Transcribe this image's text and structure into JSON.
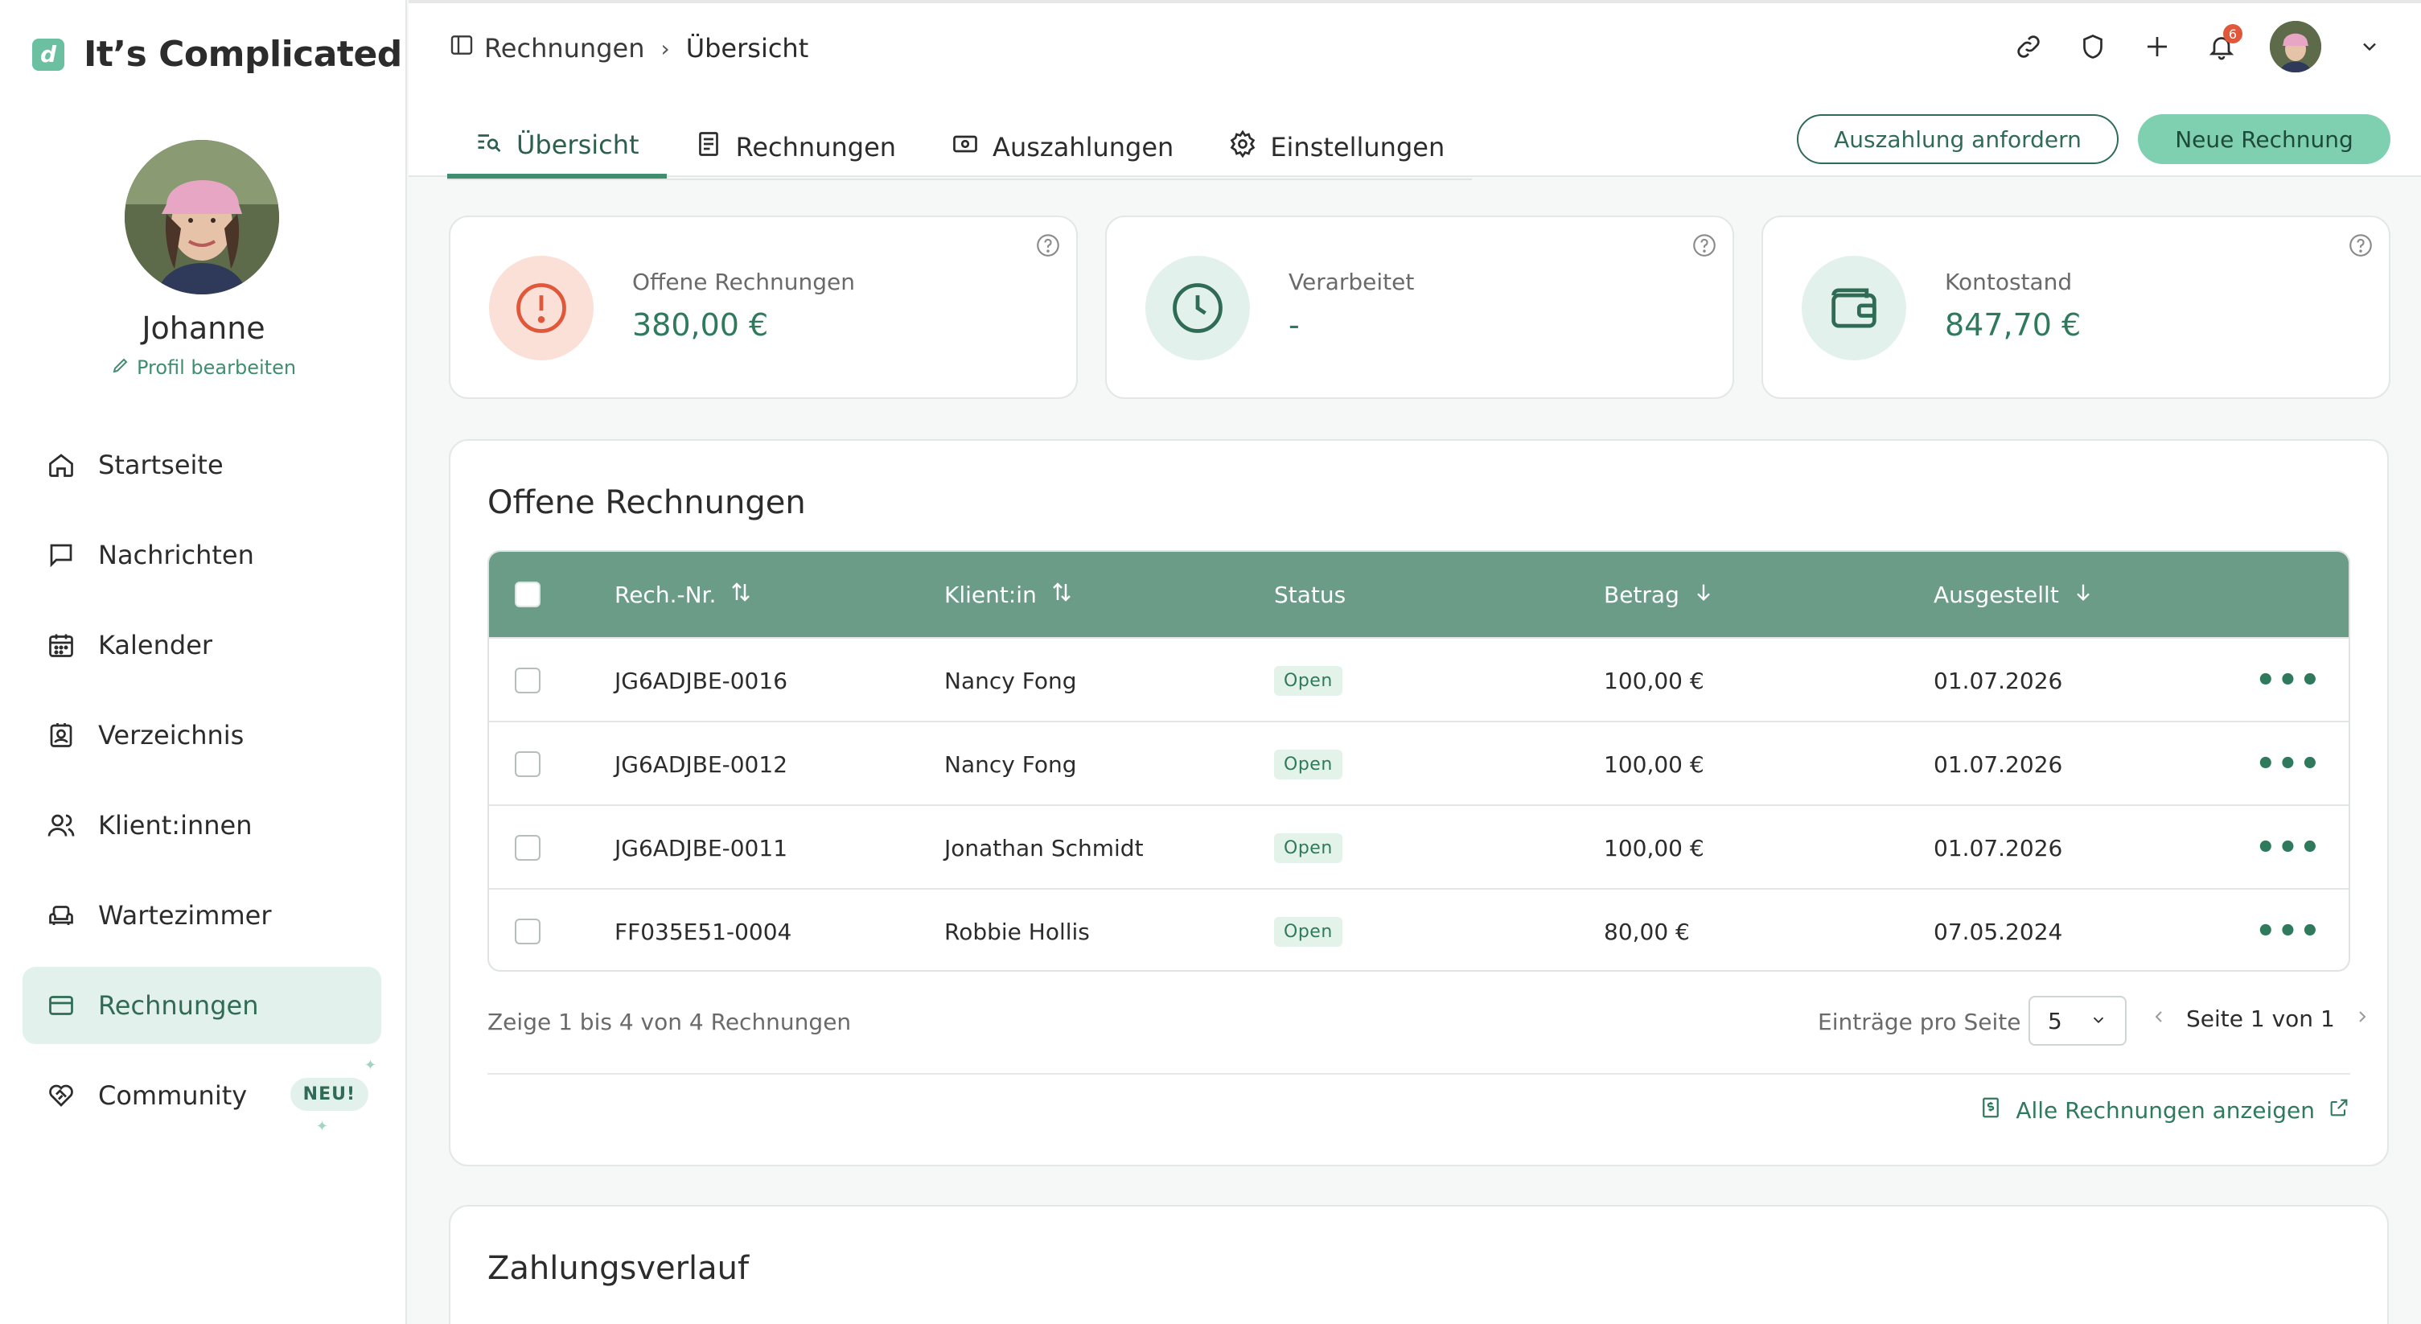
{
  "app": {
    "name": "It’s Complicated",
    "logo_letter": "d"
  },
  "profile": {
    "name": "Johanne",
    "edit_label": "Profil bearbeiten"
  },
  "sidebar": {
    "items": [
      {
        "label": "Startseite",
        "icon": "home-icon"
      },
      {
        "label": "Nachrichten",
        "icon": "message-icon"
      },
      {
        "label": "Kalender",
        "icon": "calendar-icon"
      },
      {
        "label": "Verzeichnis",
        "icon": "directory-icon"
      },
      {
        "label": "Klient:innen",
        "icon": "users-icon"
      },
      {
        "label": "Wartezimmer",
        "icon": "armchair-icon"
      },
      {
        "label": "Rechnungen",
        "icon": "card-icon",
        "active": true
      },
      {
        "label": "Community",
        "icon": "heart-handshake-icon",
        "badge": "NEU!"
      }
    ]
  },
  "breadcrumb": {
    "parent": "Rechnungen",
    "current": "Übersicht"
  },
  "notifications": {
    "count": "6"
  },
  "tabs": [
    {
      "label": "Übersicht",
      "active": true
    },
    {
      "label": "Rechnungen"
    },
    {
      "label": "Auszahlungen"
    },
    {
      "label": "Einstellungen"
    }
  ],
  "actions": {
    "payout_request": "Auszahlung anfordern",
    "new_invoice": "Neue Rechnung"
  },
  "stats": [
    {
      "title": "Offene Rechnungen",
      "value": "380,00 €"
    },
    {
      "title": "Verarbeitet",
      "value": "-"
    },
    {
      "title": "Kontostand",
      "value": "847,70 €"
    }
  ],
  "open_invoices": {
    "title": "Offene Rechnungen",
    "columns": {
      "number": "Rech.-Nr.",
      "client": "Klient:in",
      "status": "Status",
      "amount": "Betrag",
      "issued": "Ausgestellt"
    },
    "rows": [
      {
        "number": "JG6ADJBE-0016",
        "client": "Nancy Fong",
        "status": "Open",
        "amount": "100,00 €",
        "issued": "01.07.2026"
      },
      {
        "number": "JG6ADJBE-0012",
        "client": "Nancy Fong",
        "status": "Open",
        "amount": "100,00 €",
        "issued": "01.07.2026"
      },
      {
        "number": "JG6ADJBE-0011",
        "client": "Jonathan Schmidt",
        "status": "Open",
        "amount": "100,00 €",
        "issued": "01.07.2026"
      },
      {
        "number": "FF035E51-0004",
        "client": "Robbie Hollis",
        "status": "Open",
        "amount": "80,00 €",
        "issued": "07.05.2024"
      }
    ],
    "summary": "Zeige 1 bis 4 von 4 Rechnungen",
    "per_page_label": "Einträge pro Seite",
    "per_page_value": "5",
    "page_label": "Seite 1 von 1",
    "all_link": "Alle Rechnungen anzeigen"
  },
  "payment_history": {
    "title": "Zahlungsverlauf"
  },
  "colors": {
    "accent": "#3f8f6e",
    "header": "#6a9c88",
    "button": "#7fd0b0",
    "alert": "#e0573a"
  }
}
